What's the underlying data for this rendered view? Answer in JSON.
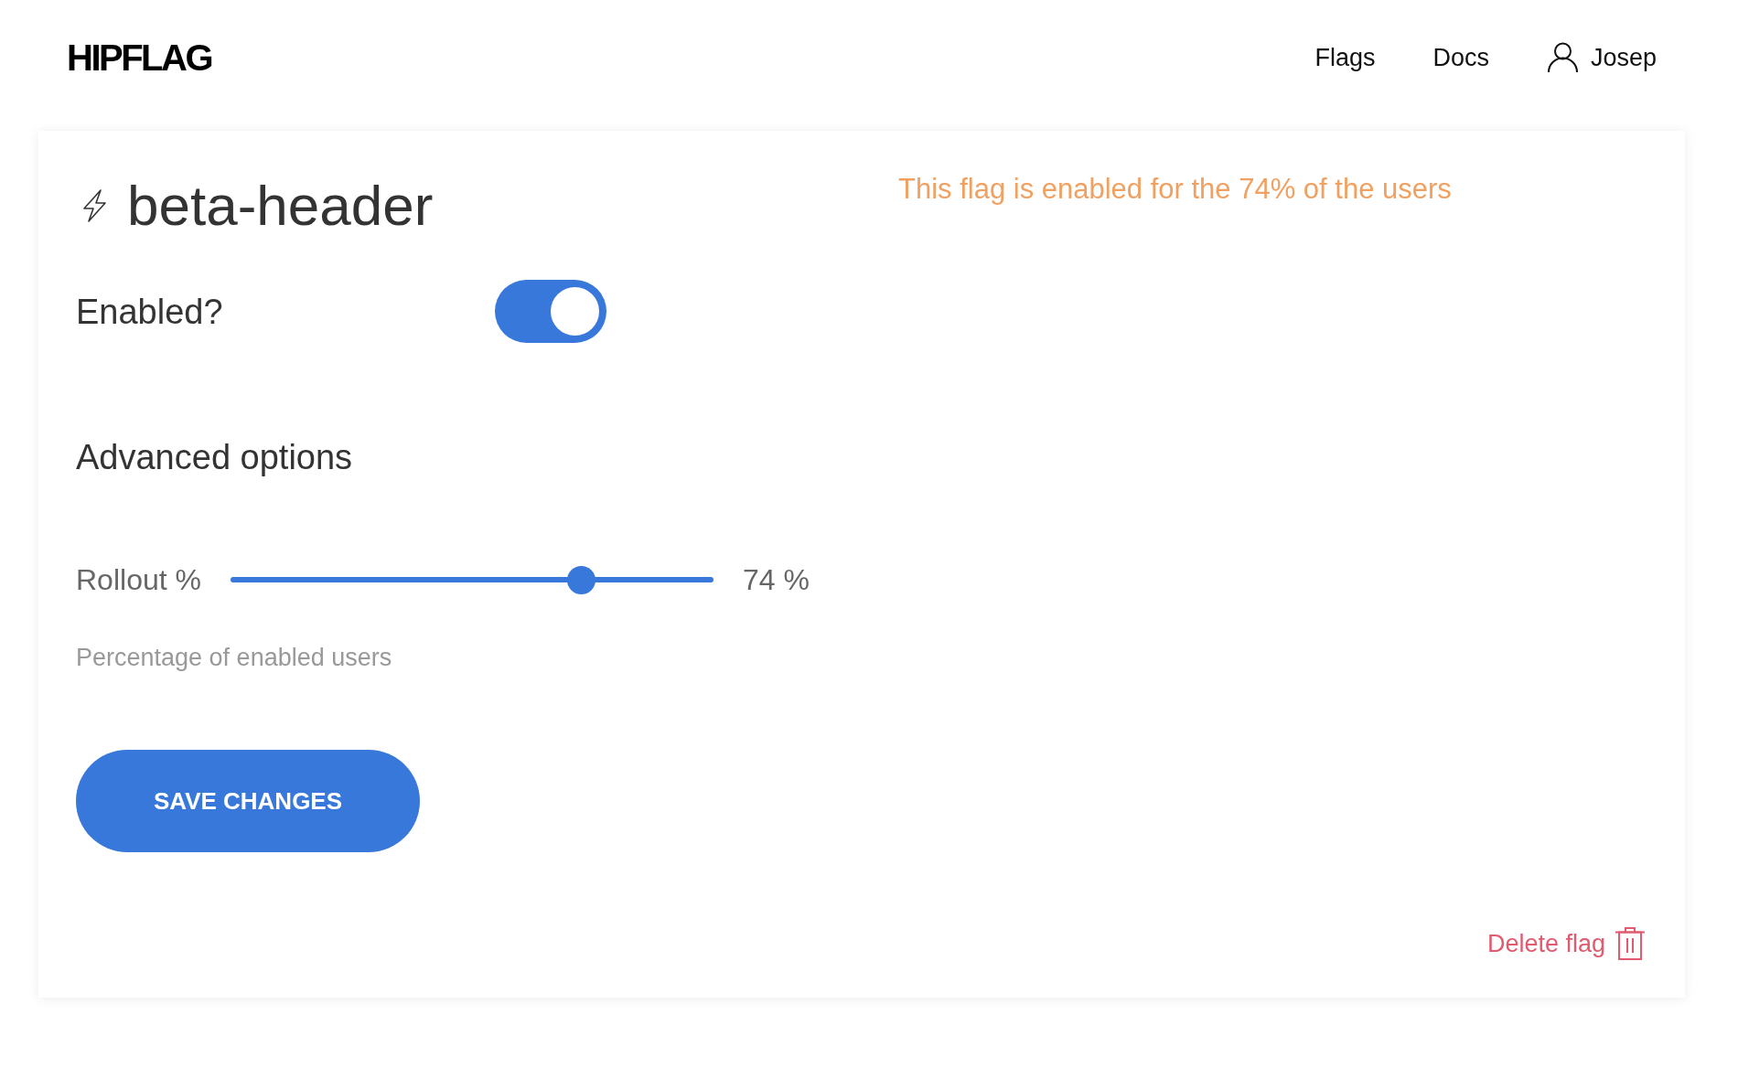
{
  "header": {
    "logo": "HIPFLAG",
    "nav": [
      {
        "label": "Flags"
      },
      {
        "label": "Docs"
      }
    ],
    "user": {
      "name": "Josep"
    }
  },
  "flag": {
    "name": "beta-header",
    "notice": "This flag is enabled for the 74% of the users",
    "enabled_label": "Enabled?",
    "enabled": true,
    "advanced_title": "Advanced options",
    "rollout": {
      "label": "Rollout %",
      "level": 0.74,
      "reading": "74 %",
      "help": "Percentage of enabled users"
    },
    "save_button": "SAVE CHANGES",
    "delete_link": "Delete flag"
  }
}
